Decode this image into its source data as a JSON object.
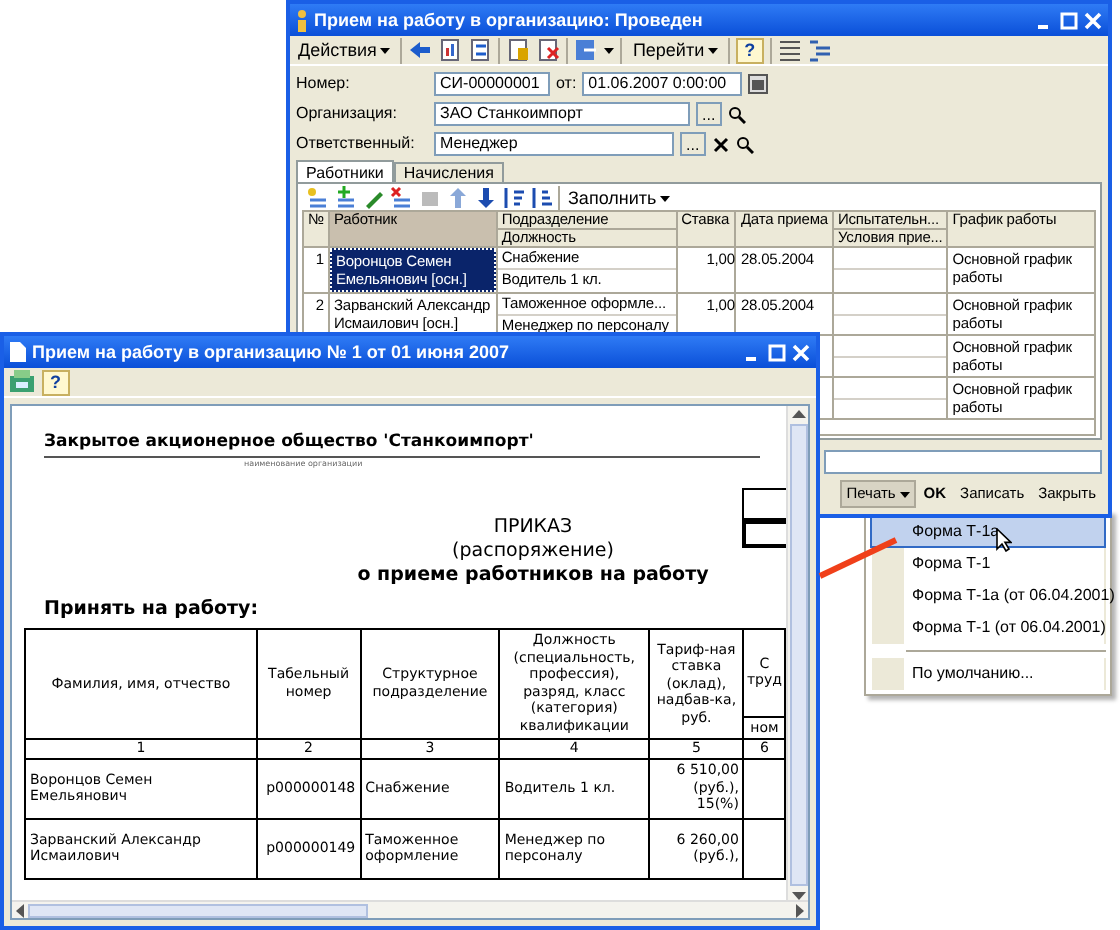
{
  "main_window": {
    "title": "Прием на работу в организацию: Проведен",
    "toolbar": {
      "actions_menu": "Действия",
      "goto_menu": "Перейти",
      "help_button": "?"
    },
    "fields": [
      {
        "kind": "number_date",
        "label": "Номер:",
        "value": "СИ-00000001",
        "extra_label": "от:",
        "extra_value": "01.06.2007  0:00:00"
      },
      {
        "kind": "reference",
        "label": "Организация:",
        "value": "ЗАО Станкоимпорт",
        "select_label": "..."
      },
      {
        "kind": "reference_clearable",
        "label": "Ответственный:",
        "value": "Менеджер",
        "select_label": "..."
      }
    ],
    "tabs": [
      {
        "label": "Работники",
        "selected": true
      },
      {
        "label": "Начисления",
        "selected": false
      }
    ],
    "table_toolbar": {
      "fill_menu": "Заполнить"
    },
    "table": {
      "columns": [
        {
          "label": "№",
          "highlighted": false
        },
        {
          "label": "Работник",
          "highlighted": true
        },
        {
          "label": "Подразделение",
          "sublabel": "Должность",
          "highlighted": false
        },
        {
          "label": "Ставка",
          "highlighted": false
        },
        {
          "label": "Дата приема",
          "highlighted": false
        },
        {
          "label": "Испытательн...",
          "sublabel": "Условия прие...",
          "highlighted": false
        },
        {
          "label": "График работы",
          "highlighted": false
        }
      ],
      "rows": [
        {
          "number": "1",
          "employee": "Воронцов Семен Емельянович [осн.]",
          "department": "Снабжение",
          "position": "Водитель 1 кл.",
          "rate": "1,00",
          "hire_date": "28.05.2004",
          "schedule": "Основной график работы",
          "selected": true
        },
        {
          "number": "2",
          "employee": "Зарванский Александр Исмаилович [осн.]",
          "department": "Таможенное оформле...",
          "position": "Менеджер по персоналу",
          "rate": "1,00",
          "hire_date": "28.05.2004",
          "schedule": "Основной график работы",
          "selected": false
        },
        {
          "schedule": "Основной график работы",
          "selected": false
        },
        {
          "schedule": "Основной график работы",
          "selected": false
        }
      ]
    },
    "print_button": {
      "label": "Печать",
      "expanded": true
    },
    "buttons": [
      {
        "label": "OK",
        "default": true
      },
      {
        "label": "Записать",
        "default": false
      },
      {
        "label": "Закрыть",
        "default": false
      }
    ]
  },
  "print_menu": {
    "items": [
      {
        "kind": "item",
        "label": "Форма Т-1а",
        "selected": true
      },
      {
        "kind": "item",
        "label": "Форма Т-1",
        "selected": false
      },
      {
        "kind": "item",
        "label": "Форма Т-1а (от 06.04.2001)",
        "selected": false
      },
      {
        "kind": "item",
        "label": "Форма Т-1 (от 06.04.2001)",
        "selected": false
      },
      {
        "kind": "separator"
      },
      {
        "kind": "item",
        "label": "По умолчанию...",
        "selected": false
      }
    ]
  },
  "print_window": {
    "title": "Прием на работу в организацию  № 1 от 01 июня 2007",
    "help_button": "?",
    "document": {
      "organization": "Закрытое акционерное общество 'Станкоимпорт'",
      "organization_caption": "наименование организации",
      "title": "ПРИКАЗ",
      "subtitle": "(распоряжение)",
      "subject": "о приеме работников на работу",
      "section": "Принять на работу:",
      "table": {
        "columns": [
          {
            "label": "Фамилия, имя, отчество",
            "number": "1"
          },
          {
            "label": "Табельный номер",
            "number": "2"
          },
          {
            "label": "Структурное подразделение",
            "number": "3"
          },
          {
            "label": "Должность (специальность, профессия), разряд, класс (категория) квалификации",
            "number": "4"
          },
          {
            "label": "Тариф-ная ставка (оклад), надбав-ка, руб.",
            "number": "5"
          },
          {
            "label": "С труд",
            "sublabel": "ном",
            "number": "6"
          }
        ],
        "rows": [
          [
            "Воронцов Семен Емельянович",
            "р000000148",
            "Снабжение",
            "Водитель 1 кл.",
            "6 510,00 (руб.), 15(%)"
          ],
          [
            "Зарванский Александр Исмаилович",
            "р000000149",
            "Таможенное оформление",
            "Менеджер по персоналу",
            "6 260,00 (руб.),"
          ]
        ]
      }
    }
  }
}
